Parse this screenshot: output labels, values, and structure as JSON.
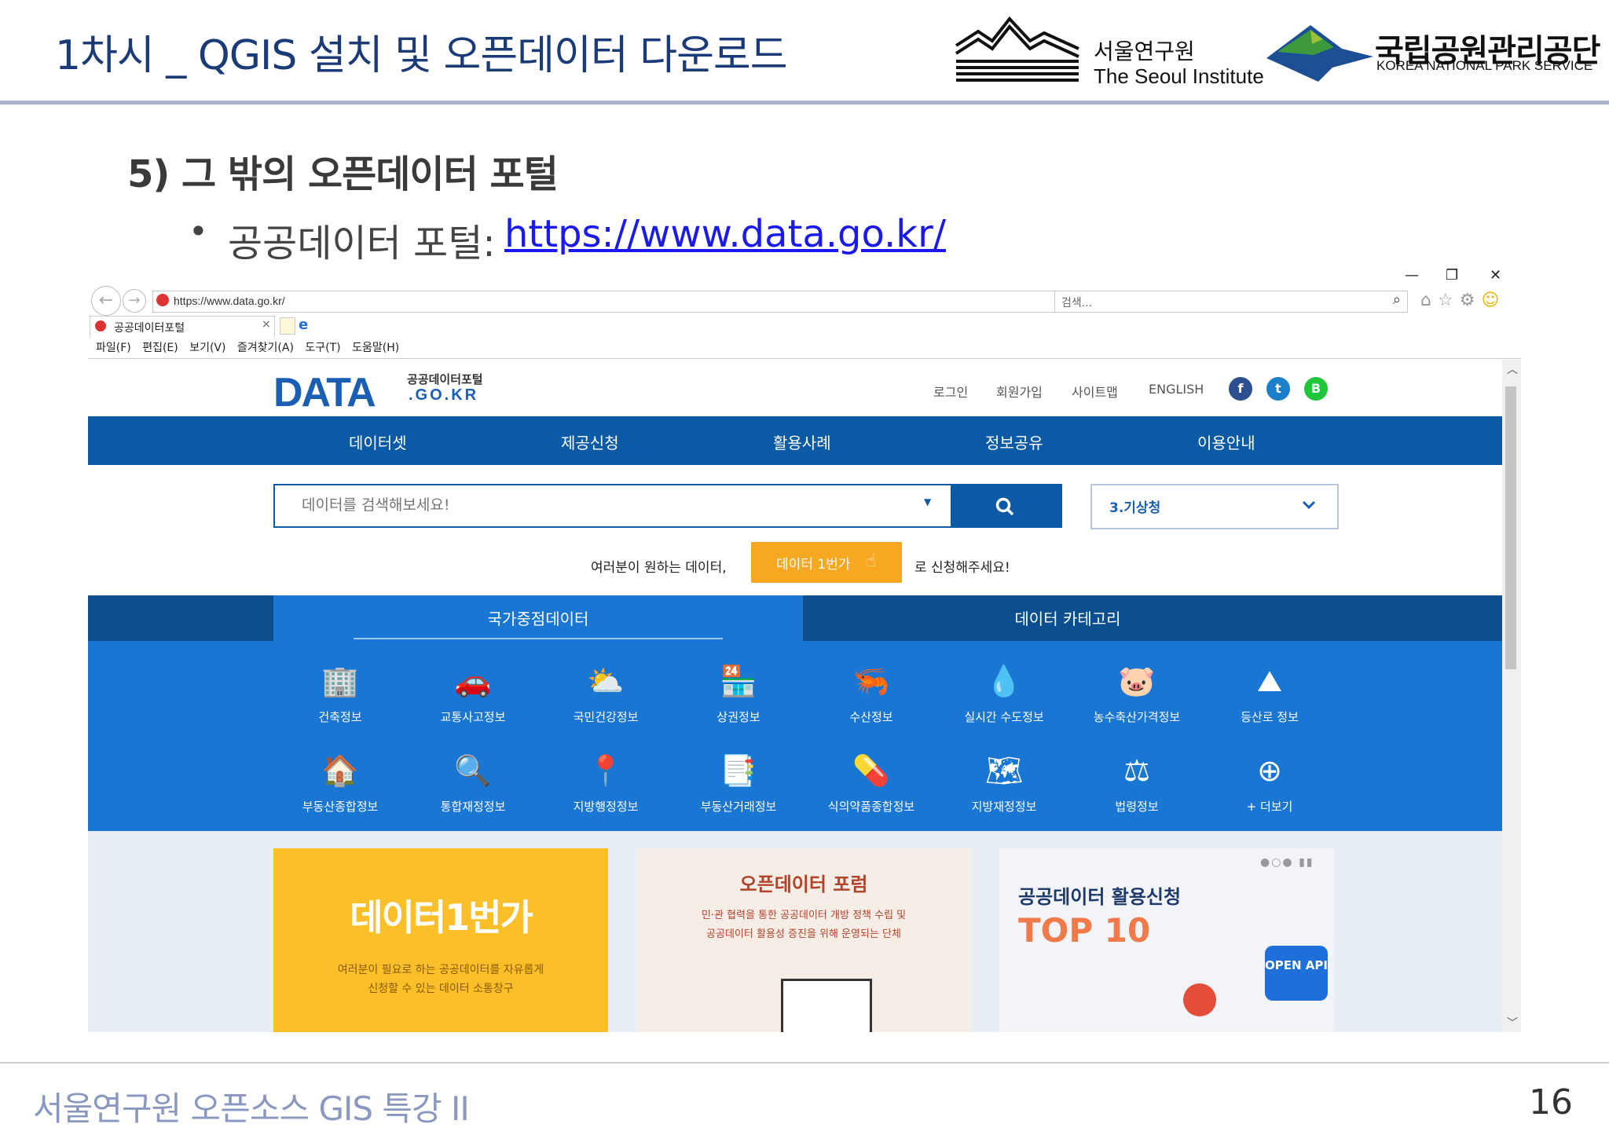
{
  "slide": {
    "title": "1차시 _ QGIS 설치 및 오픈데이터 다운로드",
    "section_heading": "5) 그 밖의 오픈데이터 포털",
    "bullet_label": "공공데이터 포털: ",
    "bullet_link": "https://www.data.go.kr/",
    "footer": "서울연구원 오픈소스 GIS 특강 II",
    "page_number": "16"
  },
  "logos": {
    "seoul_institute_kr": "서울연구원",
    "seoul_institute_en": "The Seoul Institute",
    "knps_kr": "국립공원관리공단",
    "knps_en": "KOREA NATIONAL PARK SERVICE"
  },
  "browser": {
    "window_controls": {
      "minimize": "—",
      "restore": "❐",
      "close": "✕"
    },
    "back": "←",
    "forward": "→",
    "address": "https://www.data.go.kr/",
    "search_placeholder": "검색...",
    "tab_title": "공공데이터포털",
    "tab_close": "×",
    "menu": [
      "파일(F)",
      "편집(E)",
      "보기(V)",
      "즐겨찾기(A)",
      "도구(T)",
      "도움말(H)"
    ]
  },
  "site": {
    "logo_main": "DATA",
    "logo_sub1": "공공데이터포털",
    "logo_sub2": ".GO.KR",
    "util_links": [
      "로그인",
      "회원가입",
      "사이트맵",
      "ENGLISH"
    ],
    "social": {
      "facebook": "f",
      "twitter": "t",
      "blog": "B"
    },
    "gnb": [
      "데이터셋",
      "제공신청",
      "활용사례",
      "정보공유",
      "이용안내"
    ],
    "search_placeholder": "데이터를 검색해보세요!",
    "org_selected": "3.기상청",
    "promo_pre": "여러분이 원하는 데이터,",
    "promo_button": "데이터 1번가",
    "promo_post": "로 신청해주세요!",
    "tab_national": "국가중점데이터",
    "tab_category": "데이터 카테고리",
    "categories_row1": [
      "건축정보",
      "교통사고정보",
      "국민건강정보",
      "상권정보",
      "수산정보",
      "실시간 수도정보",
      "농수축산가격정보",
      "등산로 정보"
    ],
    "categories_row2": [
      "부동산종합정보",
      "통합재정정보",
      "지방행정정보",
      "부동산거래정보",
      "식의약품종합정보",
      "지방재정정보",
      "법령정보",
      "+ 더보기"
    ],
    "card1_title": "데이터1번가",
    "card1_desc1": "여러분이 필요로 하는 공공데이터를 자유롭게",
    "card1_desc2": "신청할 수 있는 데이터 소통창구",
    "card2_title": "오픈데이터 포럼",
    "card2_desc1": "민·관 협력을 통한 공공데이터 개방 정책 수립 및",
    "card2_desc2": "공공데이터 활용성 증진을 위해 운영되는 단체",
    "card3_title": "공공데이터 활용신청",
    "card3_top": "TOP 10",
    "card3_badge": "OPEN API"
  },
  "colors": {
    "title_blue": "#1a3a78",
    "site_blue": "#0b5aa6",
    "panel_blue": "#1976d2",
    "promo_orange": "#f6a821",
    "footer_grey": "#8a98bf"
  }
}
